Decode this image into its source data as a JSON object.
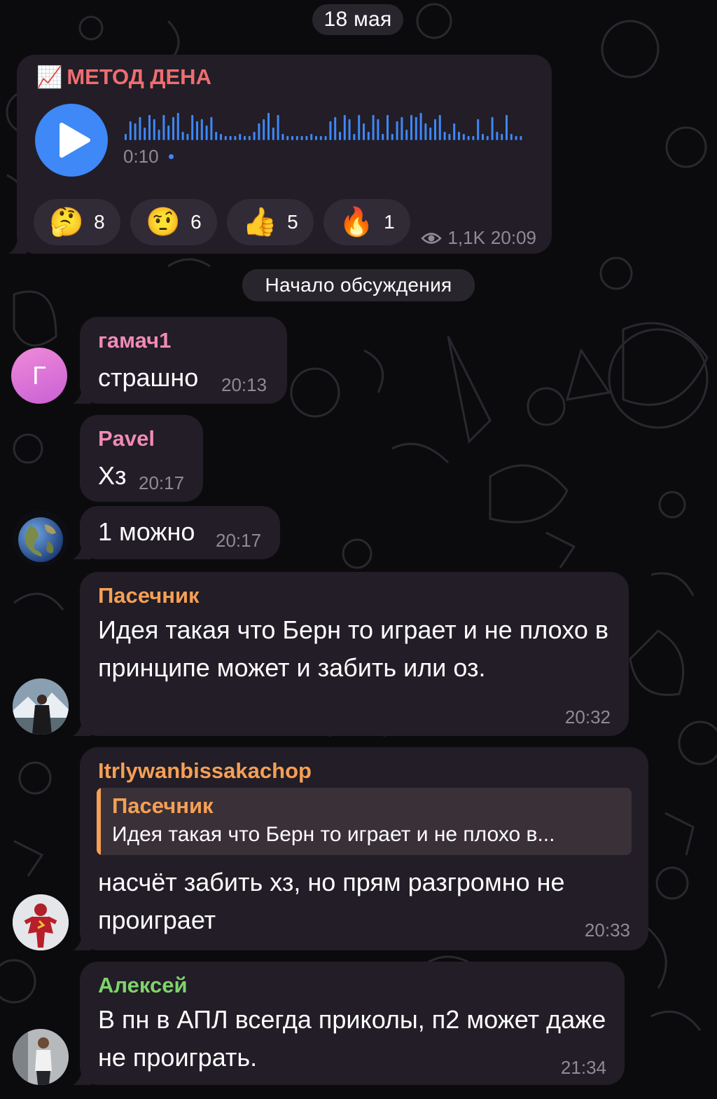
{
  "date_pill": "18 мая",
  "channel_post": {
    "title_icon": "📈",
    "title": "МЕТОД ДЕНА",
    "duration": "0:10",
    "views": "1,1K",
    "time": "20:09",
    "reactions": [
      {
        "emoji": "🤔",
        "icon": "thinking-face-icon",
        "count": "8"
      },
      {
        "emoji": "🤨",
        "icon": "raised-eyebrow-face-icon",
        "count": "6"
      },
      {
        "emoji": "👍",
        "icon": "thumbs-up-icon",
        "count": "5"
      },
      {
        "emoji": "🔥",
        "icon": "fire-icon",
        "count": "1"
      }
    ]
  },
  "discussion_pill": "Начало обсуждения",
  "messages": [
    {
      "author": "гамач1",
      "author_color": "#f08ab8",
      "avatar_letter": "Г",
      "text": "страшно",
      "time": "20:13"
    },
    {
      "author": "Pavel",
      "author_color": "#f08ab8",
      "text": "Хз",
      "time": "20:17"
    },
    {
      "text": "1 можно",
      "time": "20:17"
    },
    {
      "author": "Пасечник",
      "author_color": "#f5a054",
      "text": "Идея такая что Берн то играет и не плохо в принципе может и забить или оз.",
      "time": "20:32"
    },
    {
      "author": "Itrlywanbissakachop",
      "author_color": "#f5a054",
      "reply_author": "Пасечник",
      "reply_text": "Идея такая что Берн то играет и не плохо в...",
      "text": "насчёт забить хз, но прям разгромно не проиграет",
      "time": "20:33"
    },
    {
      "author": "Алексей",
      "author_color": "#7fd36a",
      "text": "В пн в АПЛ всегда приколы, п2 может даже не проиграть.",
      "time": "21:34"
    }
  ],
  "colors": {
    "accent_blue": "#3e88f7",
    "bubble": "#221d27",
    "reply_bar": "#f5a054"
  }
}
